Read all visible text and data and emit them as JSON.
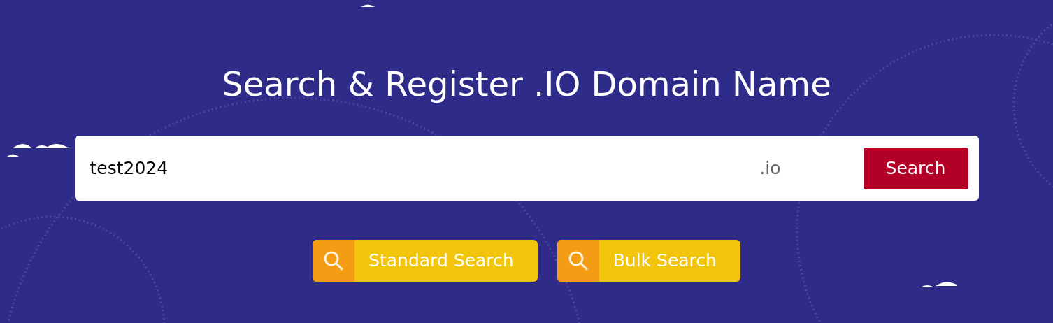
{
  "title": "Search & Register .IO Domain Name",
  "search": {
    "value": "test2024",
    "extension": ".io",
    "button": "Search"
  },
  "modes": [
    {
      "label": "Standard Search"
    },
    {
      "label": "Bulk Search"
    }
  ]
}
